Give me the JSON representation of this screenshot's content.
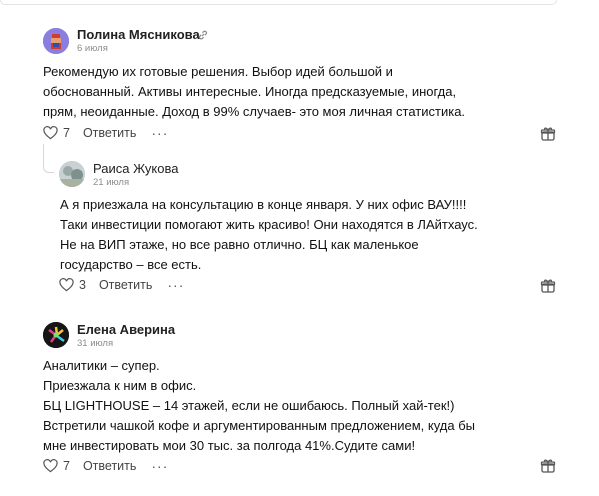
{
  "comments": [
    {
      "author": "Полина Мясникова",
      "date": "6 июля",
      "lines": [
        "Рекомендую их готовые решения. Выбор идей большой и",
        "обоснованный. Активы интересные. Иногда предсказуемые, иногда,",
        "прям, неоиданные. Доход в 99% случаев- это моя личная статистика."
      ],
      "likes": "7",
      "reply_label": "Ответить"
    },
    {
      "author": "Раиса Жукова",
      "date": "21 июля",
      "lines": [
        "А я приезжала на консультацию в конце января. У них офис ВАУ!!!!",
        "Таки инвестиции помогают жить красиво! Они находятся в ЛАйтхаус.",
        "Не на ВИП этаже, но все равно отлично. БЦ как маленькое",
        "государство – все есть."
      ],
      "likes": "3",
      "reply_label": "Ответить"
    },
    {
      "author": "Елена Аверина",
      "date": "31 июля",
      "lines": [
        "Аналитики – супер.",
        "Приезжала к ним в офис.",
        "БЦ LIGHTHOUSE – 14 этажей, если не ошибаюсь. Полный хай-тек!)",
        "Встретили чашкой кофе и аргументированным предложением, куда бы",
        "мне инвестировать мои 30 тыс. за полгода 41%.Судите сами!"
      ],
      "likes": "7",
      "reply_label": "Ответить"
    }
  ],
  "colors": {
    "avatar1": "#7b6fd6",
    "avatar2": "#b9c3c9",
    "avatar3": "#1a1a1a"
  }
}
